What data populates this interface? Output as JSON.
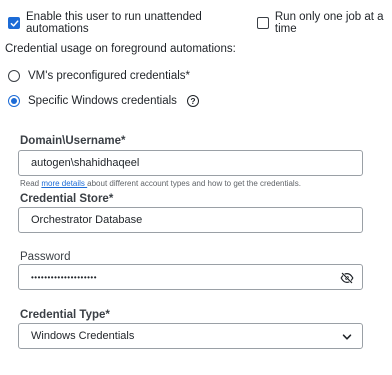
{
  "options": {
    "unattended_label": "Enable this user to run unattended automations",
    "unattended_checked": true,
    "one_job_label": "Run only one job at a time",
    "one_job_checked": false
  },
  "credential_usage": {
    "heading": "Credential usage on foreground automations:",
    "radio_vm": "VM's preconfigured credentials*",
    "radio_specific": "Specific Windows credentials",
    "selected": "Specific Windows credentials"
  },
  "fields": {
    "domain_username": {
      "label": "Domain\\Username*",
      "value": "autogen\\shahidhaqeel"
    },
    "helper": {
      "prefix": "Read ",
      "link": "more details ",
      "suffix": "about different account types and how to get the credentials."
    },
    "credential_store": {
      "label": "Credential Store*",
      "value": "Orchestrator Database"
    },
    "password": {
      "label": "Password",
      "value": "••••••••••••••••••••"
    },
    "credential_type": {
      "label": "Credential Type*",
      "value": "Windows Credentials"
    }
  },
  "icons": {
    "checkbox_checked": "check-icon",
    "help": "question-circle-icon",
    "password_toggle": "eye-slash-icon",
    "dropdown": "chevron-down-icon"
  },
  "colors": {
    "accent": "#1c6bd6",
    "text": "#1f2328",
    "border": "#9aa0a6"
  }
}
